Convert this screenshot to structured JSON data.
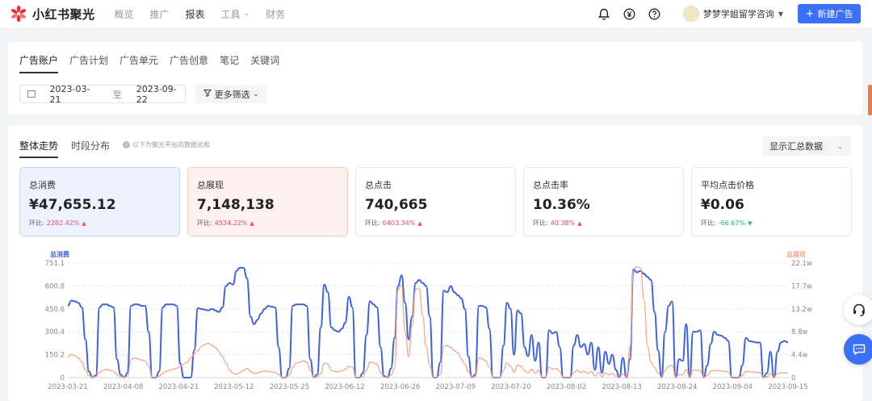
{
  "header": {
    "brand": "小红书聚光",
    "nav": [
      {
        "label": "概览",
        "active": false
      },
      {
        "label": "推广",
        "active": false
      },
      {
        "label": "报表",
        "active": true
      },
      {
        "label": "工具",
        "active": false,
        "dropdown": true
      },
      {
        "label": "财务",
        "active": false
      }
    ],
    "icons": [
      "bell-icon",
      "yen-circle-icon",
      "help-circle-icon"
    ],
    "user_name": "梦梦学姐留学咨询",
    "new_ad_label": "新建广告",
    "accent": "#3a6ff8",
    "brand_color": "#ff2442"
  },
  "report_tabs": [
    {
      "label": "广告账户",
      "active": true
    },
    {
      "label": "广告计划",
      "active": false
    },
    {
      "label": "广告单元",
      "active": false
    },
    {
      "label": "广告创意",
      "active": false
    },
    {
      "label": "笔记",
      "active": false
    },
    {
      "label": "关键词",
      "active": false
    }
  ],
  "filters": {
    "start_date": "2023-03-21",
    "separator": "至",
    "end_date": "2023-09-22",
    "more_filters_label": "更多筛选"
  },
  "overview": {
    "tabs": [
      {
        "label": "整体走势",
        "active": true
      },
      {
        "label": "时段分布",
        "active": false
      }
    ],
    "hint": "以下为聚光平台的数据总和",
    "summary_select": "显示汇总数据"
  },
  "cards": [
    {
      "title": "总消费",
      "value": "¥47,655.12",
      "compare_label": "环比:",
      "compare_value": "2282.42%",
      "trend": "up",
      "style": "blue"
    },
    {
      "title": "总展现",
      "value": "7,148,138",
      "compare_label": "环比:",
      "compare_value": "4534.22%",
      "trend": "up",
      "style": "peach"
    },
    {
      "title": "总点击",
      "value": "740,665",
      "compare_label": "环比:",
      "compare_value": "6403.34%",
      "trend": "up",
      "style": "plain"
    },
    {
      "title": "总点击率",
      "value": "10.36%",
      "compare_label": "环比:",
      "compare_value": "40.38%",
      "trend": "up",
      "style": "plain"
    },
    {
      "title": "平均点击价格",
      "value": "¥0.06",
      "compare_label": "环比:",
      "compare_value": "-66.67%",
      "trend": "down",
      "style": "plain"
    }
  ],
  "colors": {
    "up": "#f04d5e",
    "down": "#2bb673",
    "series_left": "#3d63dd",
    "series_right": "#f3a98a"
  },
  "chart_data": {
    "type": "line",
    "left_axis_label": "总消费",
    "right_axis_label": "总展现",
    "left_ticks": [
      "751.1",
      "600.8",
      "450.6",
      "300.4",
      "150.2",
      "0"
    ],
    "left_ylim": [
      0,
      751.1
    ],
    "right_ticks": [
      "22.1w",
      "17.7w",
      "13.2w",
      "8.8w",
      "4.4w",
      "0"
    ],
    "right_ylim": [
      0,
      221000
    ],
    "x_ticks": [
      "2023-03-21",
      "2023-04-08",
      "2023-04-21",
      "2023-05-12",
      "2023-05-25",
      "2023-06-12",
      "2023-06-26",
      "2023-07-09",
      "2023-07-20",
      "2023-08-02",
      "2023-08-13",
      "2023-08-24",
      "2023-09-04",
      "2023-09-15"
    ],
    "grid": "horizontal dashed",
    "series": [
      {
        "name": "总消费",
        "axis": "left",
        "color": "#3d63dd",
        "values": [
          470,
          505,
          500,
          490,
          460,
          250,
          40,
          0,
          15,
          460,
          480,
          480,
          470,
          460,
          120,
          20,
          0,
          30,
          470,
          480,
          480,
          470,
          470,
          300,
          0,
          0,
          40,
          460,
          480,
          480,
          480,
          470,
          90,
          0,
          0,
          0,
          180,
          455,
          450,
          445,
          440,
          450,
          440,
          430,
          460,
          600,
          620,
          610,
          700,
          720,
          720,
          650,
          400,
          350,
          380,
          420,
          450,
          470,
          465,
          460,
          200,
          0,
          0,
          60,
          470,
          480,
          480,
          480,
          470,
          120,
          0,
          20,
          330,
          610,
          560,
          330,
          310,
          300,
          320,
          360,
          530,
          460,
          0,
          0,
          30,
          280,
          500,
          480,
          460,
          200,
          10,
          0,
          60,
          260,
          600,
          670,
          490,
          250,
          400,
          620,
          640,
          620,
          600,
          400,
          0,
          0,
          100,
          570,
          560,
          600,
          560,
          540,
          520,
          450,
          140,
          0,
          20,
          470,
          470,
          460,
          320,
          0,
          0,
          0,
          210,
          490,
          450,
          150,
          440,
          420,
          200,
          140,
          280,
          110,
          230,
          0,
          0,
          310,
          290,
          300,
          200,
          0,
          0,
          0,
          210,
          280,
          200,
          220,
          150,
          230,
          50,
          200,
          30,
          170,
          90,
          150,
          50,
          0,
          130,
          0,
          120,
          710,
          690,
          700,
          680,
          660,
          640,
          430,
          180,
          0,
          300,
          470,
          500,
          0,
          120,
          110,
          350,
          0,
          300,
          300,
          310,
          0,
          80,
          220,
          300,
          280,
          275,
          260,
          240,
          0,
          0,
          0,
          80,
          260,
          240,
          235,
          230,
          230,
          0,
          30,
          170,
          0,
          170,
          230,
          240,
          230
        ]
      },
      {
        "name": "总展现",
        "axis": "right",
        "color": "#f3a98a",
        "values": [
          40000,
          45000,
          42000,
          38000,
          30000,
          15000,
          4000,
          0,
          2000,
          10000,
          14000,
          16000,
          14000,
          12000,
          6000,
          2000,
          0,
          3000,
          35000,
          38000,
          36000,
          34000,
          32000,
          22000,
          0,
          0,
          3000,
          8000,
          12000,
          14000,
          16000,
          18000,
          22000,
          26000,
          30000,
          38000,
          46000,
          52000,
          60000,
          64000,
          66000,
          62000,
          58000,
          50000,
          40000,
          28000,
          15000,
          8000,
          6000,
          10000,
          14000,
          18000,
          12000,
          8000,
          9000,
          11000,
          13000,
          12000,
          11000,
          10000,
          6000,
          0,
          0,
          4000,
          20000,
          28000,
          30000,
          32000,
          30000,
          14000,
          0,
          1000,
          8000,
          28000,
          26000,
          14000,
          12000,
          11000,
          13000,
          16000,
          22000,
          20000,
          0,
          0,
          2000,
          14000,
          30000,
          28000,
          26000,
          10000,
          1000,
          0,
          5000,
          18000,
          170000,
          178000,
          90000,
          40000,
          100000,
          170000,
          172000,
          120000,
          60000,
          24000,
          0,
          0,
          6000,
          60000,
          62000,
          58000,
          52000,
          48000,
          36000,
          26000,
          12000,
          0,
          2000,
          38000,
          36000,
          32000,
          20000,
          0,
          0,
          0,
          14000,
          28000,
          22000,
          10000,
          24000,
          22000,
          14000,
          9000,
          16000,
          8000,
          14000,
          0,
          0,
          20000,
          16000,
          18000,
          12000,
          0,
          0,
          0,
          10000,
          14000,
          10000,
          12000,
          8000,
          12000,
          3000,
          10000,
          2000,
          9000,
          5000,
          8000,
          3000,
          0,
          7000,
          0,
          60000,
          210000,
          214000,
          212000,
          150000,
          60000,
          30000,
          20000,
          9000,
          0,
          14000,
          22000,
          24000,
          0,
          6000,
          5000,
          16000,
          0,
          15000,
          14000,
          14000,
          0,
          4000,
          12000,
          14000,
          13000,
          13000,
          12000,
          11000,
          0,
          0,
          0,
          4000,
          12000,
          11000,
          11000,
          10000,
          10000,
          0,
          2000,
          8000,
          0,
          8000,
          9000,
          9000,
          9000
        ]
      }
    ]
  }
}
